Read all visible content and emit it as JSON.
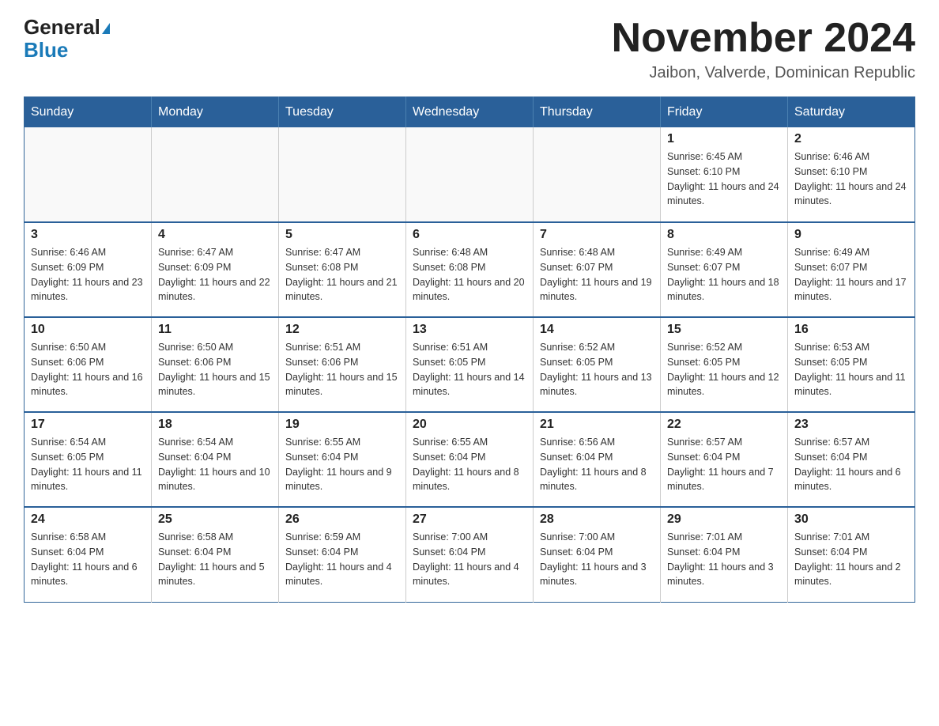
{
  "logo": {
    "general": "General",
    "blue": "Blue"
  },
  "title": "November 2024",
  "subtitle": "Jaibon, Valverde, Dominican Republic",
  "days_of_week": [
    "Sunday",
    "Monday",
    "Tuesday",
    "Wednesday",
    "Thursday",
    "Friday",
    "Saturday"
  ],
  "weeks": [
    [
      {
        "day": "",
        "sunrise": "",
        "sunset": "",
        "daylight": "",
        "empty": true
      },
      {
        "day": "",
        "sunrise": "",
        "sunset": "",
        "daylight": "",
        "empty": true
      },
      {
        "day": "",
        "sunrise": "",
        "sunset": "",
        "daylight": "",
        "empty": true
      },
      {
        "day": "",
        "sunrise": "",
        "sunset": "",
        "daylight": "",
        "empty": true
      },
      {
        "day": "",
        "sunrise": "",
        "sunset": "",
        "daylight": "",
        "empty": true
      },
      {
        "day": "1",
        "sunrise": "Sunrise: 6:45 AM",
        "sunset": "Sunset: 6:10 PM",
        "daylight": "Daylight: 11 hours and 24 minutes.",
        "empty": false
      },
      {
        "day": "2",
        "sunrise": "Sunrise: 6:46 AM",
        "sunset": "Sunset: 6:10 PM",
        "daylight": "Daylight: 11 hours and 24 minutes.",
        "empty": false
      }
    ],
    [
      {
        "day": "3",
        "sunrise": "Sunrise: 6:46 AM",
        "sunset": "Sunset: 6:09 PM",
        "daylight": "Daylight: 11 hours and 23 minutes.",
        "empty": false
      },
      {
        "day": "4",
        "sunrise": "Sunrise: 6:47 AM",
        "sunset": "Sunset: 6:09 PM",
        "daylight": "Daylight: 11 hours and 22 minutes.",
        "empty": false
      },
      {
        "day": "5",
        "sunrise": "Sunrise: 6:47 AM",
        "sunset": "Sunset: 6:08 PM",
        "daylight": "Daylight: 11 hours and 21 minutes.",
        "empty": false
      },
      {
        "day": "6",
        "sunrise": "Sunrise: 6:48 AM",
        "sunset": "Sunset: 6:08 PM",
        "daylight": "Daylight: 11 hours and 20 minutes.",
        "empty": false
      },
      {
        "day": "7",
        "sunrise": "Sunrise: 6:48 AM",
        "sunset": "Sunset: 6:07 PM",
        "daylight": "Daylight: 11 hours and 19 minutes.",
        "empty": false
      },
      {
        "day": "8",
        "sunrise": "Sunrise: 6:49 AM",
        "sunset": "Sunset: 6:07 PM",
        "daylight": "Daylight: 11 hours and 18 minutes.",
        "empty": false
      },
      {
        "day": "9",
        "sunrise": "Sunrise: 6:49 AM",
        "sunset": "Sunset: 6:07 PM",
        "daylight": "Daylight: 11 hours and 17 minutes.",
        "empty": false
      }
    ],
    [
      {
        "day": "10",
        "sunrise": "Sunrise: 6:50 AM",
        "sunset": "Sunset: 6:06 PM",
        "daylight": "Daylight: 11 hours and 16 minutes.",
        "empty": false
      },
      {
        "day": "11",
        "sunrise": "Sunrise: 6:50 AM",
        "sunset": "Sunset: 6:06 PM",
        "daylight": "Daylight: 11 hours and 15 minutes.",
        "empty": false
      },
      {
        "day": "12",
        "sunrise": "Sunrise: 6:51 AM",
        "sunset": "Sunset: 6:06 PM",
        "daylight": "Daylight: 11 hours and 15 minutes.",
        "empty": false
      },
      {
        "day": "13",
        "sunrise": "Sunrise: 6:51 AM",
        "sunset": "Sunset: 6:05 PM",
        "daylight": "Daylight: 11 hours and 14 minutes.",
        "empty": false
      },
      {
        "day": "14",
        "sunrise": "Sunrise: 6:52 AM",
        "sunset": "Sunset: 6:05 PM",
        "daylight": "Daylight: 11 hours and 13 minutes.",
        "empty": false
      },
      {
        "day": "15",
        "sunrise": "Sunrise: 6:52 AM",
        "sunset": "Sunset: 6:05 PM",
        "daylight": "Daylight: 11 hours and 12 minutes.",
        "empty": false
      },
      {
        "day": "16",
        "sunrise": "Sunrise: 6:53 AM",
        "sunset": "Sunset: 6:05 PM",
        "daylight": "Daylight: 11 hours and 11 minutes.",
        "empty": false
      }
    ],
    [
      {
        "day": "17",
        "sunrise": "Sunrise: 6:54 AM",
        "sunset": "Sunset: 6:05 PM",
        "daylight": "Daylight: 11 hours and 11 minutes.",
        "empty": false
      },
      {
        "day": "18",
        "sunrise": "Sunrise: 6:54 AM",
        "sunset": "Sunset: 6:04 PM",
        "daylight": "Daylight: 11 hours and 10 minutes.",
        "empty": false
      },
      {
        "day": "19",
        "sunrise": "Sunrise: 6:55 AM",
        "sunset": "Sunset: 6:04 PM",
        "daylight": "Daylight: 11 hours and 9 minutes.",
        "empty": false
      },
      {
        "day": "20",
        "sunrise": "Sunrise: 6:55 AM",
        "sunset": "Sunset: 6:04 PM",
        "daylight": "Daylight: 11 hours and 8 minutes.",
        "empty": false
      },
      {
        "day": "21",
        "sunrise": "Sunrise: 6:56 AM",
        "sunset": "Sunset: 6:04 PM",
        "daylight": "Daylight: 11 hours and 8 minutes.",
        "empty": false
      },
      {
        "day": "22",
        "sunrise": "Sunrise: 6:57 AM",
        "sunset": "Sunset: 6:04 PM",
        "daylight": "Daylight: 11 hours and 7 minutes.",
        "empty": false
      },
      {
        "day": "23",
        "sunrise": "Sunrise: 6:57 AM",
        "sunset": "Sunset: 6:04 PM",
        "daylight": "Daylight: 11 hours and 6 minutes.",
        "empty": false
      }
    ],
    [
      {
        "day": "24",
        "sunrise": "Sunrise: 6:58 AM",
        "sunset": "Sunset: 6:04 PM",
        "daylight": "Daylight: 11 hours and 6 minutes.",
        "empty": false
      },
      {
        "day": "25",
        "sunrise": "Sunrise: 6:58 AM",
        "sunset": "Sunset: 6:04 PM",
        "daylight": "Daylight: 11 hours and 5 minutes.",
        "empty": false
      },
      {
        "day": "26",
        "sunrise": "Sunrise: 6:59 AM",
        "sunset": "Sunset: 6:04 PM",
        "daylight": "Daylight: 11 hours and 4 minutes.",
        "empty": false
      },
      {
        "day": "27",
        "sunrise": "Sunrise: 7:00 AM",
        "sunset": "Sunset: 6:04 PM",
        "daylight": "Daylight: 11 hours and 4 minutes.",
        "empty": false
      },
      {
        "day": "28",
        "sunrise": "Sunrise: 7:00 AM",
        "sunset": "Sunset: 6:04 PM",
        "daylight": "Daylight: 11 hours and 3 minutes.",
        "empty": false
      },
      {
        "day": "29",
        "sunrise": "Sunrise: 7:01 AM",
        "sunset": "Sunset: 6:04 PM",
        "daylight": "Daylight: 11 hours and 3 minutes.",
        "empty": false
      },
      {
        "day": "30",
        "sunrise": "Sunrise: 7:01 AM",
        "sunset": "Sunset: 6:04 PM",
        "daylight": "Daylight: 11 hours and 2 minutes.",
        "empty": false
      }
    ]
  ]
}
